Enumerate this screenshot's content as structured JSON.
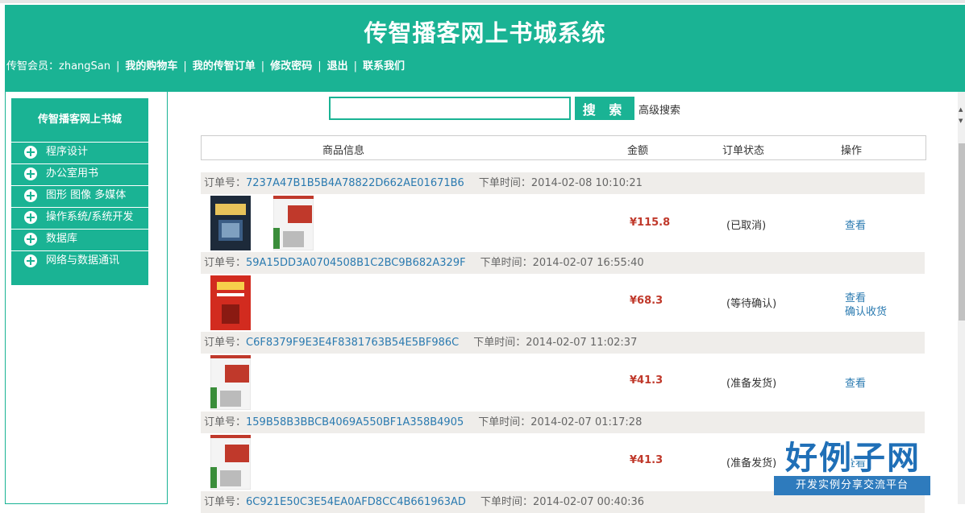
{
  "header": {
    "title": "传智播客网上书城系统",
    "member_label": "传智会员：zhangSan",
    "separator": "|",
    "links": [
      "我的购物车",
      "我的传智订单",
      "修改密码",
      "退出",
      "联系我们"
    ]
  },
  "sidebar": {
    "title": "传智播客网上书城",
    "categories": [
      "程序设计",
      "办公室用书",
      "图形 图像 多媒体",
      "操作系统/系统开发",
      "数据库",
      "网络与数据通讯"
    ]
  },
  "search": {
    "value": "",
    "button_label": "搜 索",
    "advanced_label": "高级搜索"
  },
  "table": {
    "columns": [
      "商品信息",
      "金额",
      "订单状态",
      "操作"
    ]
  },
  "labels": {
    "order_no": "订单号：",
    "order_time": "下单时间：",
    "view": "查看",
    "confirm": "确认收货"
  },
  "orders": [
    {
      "no": "7237A47B1B5B4A78822D662AE01671B6",
      "time": "2014-02-08 10:10:21",
      "price": "¥115.8",
      "status": "(已取消)",
      "actions": [
        "查看"
      ]
    },
    {
      "no": "59A15DD3A0704508B1C2BC9B682A329F",
      "time": "2014-02-07 16:55:40",
      "price": "¥68.3",
      "status": "(等待确认)",
      "actions": [
        "查看",
        "确认收货"
      ]
    },
    {
      "no": "C6F8379F9E3E4F8381763B54E5BF986C",
      "time": "2014-02-07 11:02:37",
      "price": "¥41.3",
      "status": "(准备发货)",
      "actions": [
        "查看"
      ]
    },
    {
      "no": "159B58B3BBCB4069A550BF1A358B4905",
      "time": "2014-02-07 01:17:28",
      "price": "¥41.3",
      "status": "(准备发货)",
      "actions": [
        "查看"
      ]
    },
    {
      "no": "6C921E50C3E54EA0AFD8CC4B661963AD",
      "time": "2014-02-07 00:40:36"
    }
  ],
  "watermark": {
    "main": "好例子网",
    "sub": "开发实例分享交流平台"
  },
  "icons": [
    "plus-circle-icon",
    "java-book-cover",
    "scroll-up-icon",
    "scroll-down-icon"
  ],
  "colors": {
    "brand": "#1ab394",
    "link": "#2a7ab0",
    "price": "#c0392b",
    "order_bar": "#efedea"
  }
}
